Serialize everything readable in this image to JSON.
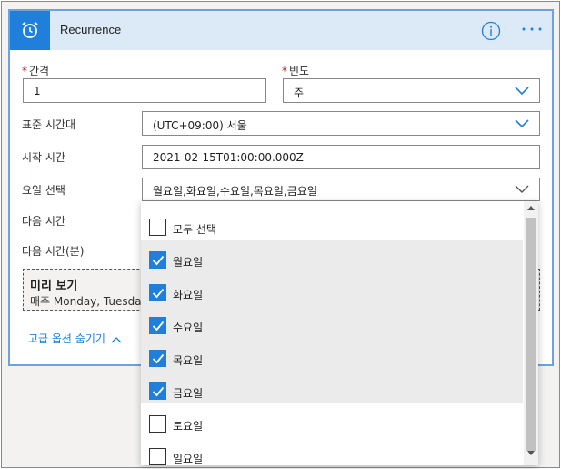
{
  "card": {
    "title": "Recurrence",
    "accent_color": "#1f7fdb",
    "header_bg": "#dce9f7",
    "icon": "alarm-clock-icon"
  },
  "fields": {
    "interval_label": "간격",
    "interval_value": "1",
    "frequency_label": "빈도",
    "frequency_value": "주",
    "timezone_label": "표준 시간대",
    "timezone_value": "(UTC+09:00) 서울",
    "start_time_label": "시작 시간",
    "start_time_value": "2021-02-15T01:00:00.000Z",
    "weekday_label": "요일 선택",
    "weekday_value": "월요일,화요일,수요일,목요일,금요일",
    "next_hours_label": "다음 시간",
    "next_minutes_label": "다음 시간(분)"
  },
  "preview": {
    "title": "미리 보기",
    "text": "매주 Monday, Tuesday,"
  },
  "advanced_link": "고급 옵션 숨기기",
  "weekday_dropdown": {
    "options": [
      {
        "label": "모두 선택",
        "checked": false
      },
      {
        "label": "월요일",
        "checked": true
      },
      {
        "label": "화요일",
        "checked": true
      },
      {
        "label": "수요일",
        "checked": true
      },
      {
        "label": "목요일",
        "checked": true
      },
      {
        "label": "금요일",
        "checked": true
      },
      {
        "label": "토요일",
        "checked": false
      },
      {
        "label": "일요일",
        "checked": false
      }
    ]
  }
}
